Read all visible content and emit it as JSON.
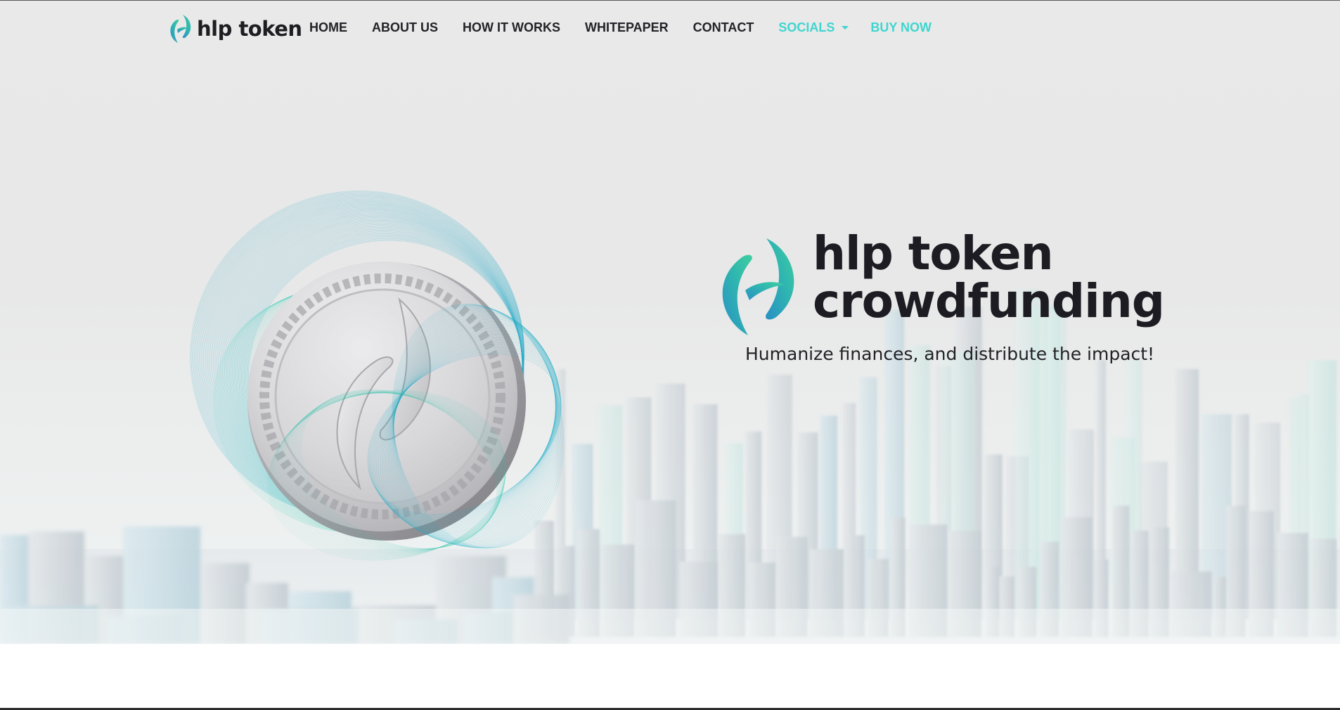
{
  "brand": {
    "name": "hlp token"
  },
  "nav": {
    "items": [
      {
        "label": "HOME"
      },
      {
        "label": "ABOUT US"
      },
      {
        "label": "HOW IT WORKS"
      },
      {
        "label": "WHITEPAPER"
      },
      {
        "label": "CONTACT"
      }
    ],
    "socials_label": "SOCIALS",
    "buy_label": "BUY NOW"
  },
  "hero": {
    "title_line1": "hlp token",
    "title_line2": "crowdfunding",
    "tagline": "Humanize finances, and distribute the impact!",
    "coin_icon": "hlp-token-coin-icon",
    "background": "city-skyline"
  },
  "colors": {
    "accent": "#3fd6cf",
    "text_dark": "#1c1c22",
    "background": "#e9e9e9",
    "teal_dark": "#1f9fc0",
    "teal_light": "#43d6b6"
  }
}
